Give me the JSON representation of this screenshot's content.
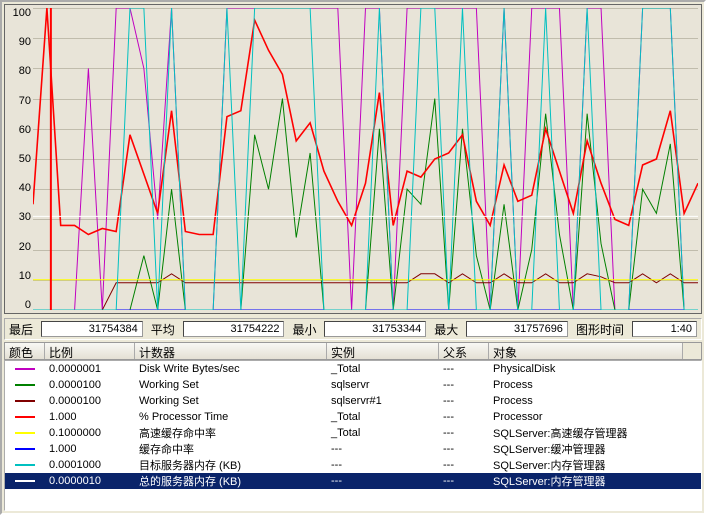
{
  "chart_data": {
    "type": "line",
    "ylim": [
      0,
      100
    ],
    "yticks": [
      100,
      90,
      80,
      70,
      60,
      50,
      40,
      30,
      20,
      10,
      0
    ],
    "series": [
      {
        "name": "Disk Write Bytes/sec",
        "color": "#c000c0",
        "values": [
          0,
          0,
          0,
          0,
          80,
          0,
          100,
          100,
          80,
          30,
          100,
          0,
          0,
          0,
          100,
          100,
          100,
          100,
          100,
          100,
          100,
          100,
          100,
          0,
          100,
          100,
          0,
          100,
          100,
          100,
          100,
          100,
          100,
          0,
          100,
          0,
          100,
          100,
          100,
          0,
          100,
          100,
          0,
          0,
          100,
          100,
          100,
          0,
          0
        ]
      },
      {
        "name": "Working Set sqlservr",
        "color": "#008000",
        "values": [
          0,
          0,
          0,
          0,
          0,
          0,
          0,
          0,
          18,
          0,
          40,
          0,
          0,
          0,
          0,
          0,
          58,
          40,
          70,
          24,
          52,
          0,
          0,
          0,
          0,
          60,
          0,
          40,
          35,
          70,
          0,
          60,
          18,
          0,
          35,
          0,
          20,
          65,
          25,
          0,
          65,
          22,
          0,
          0,
          40,
          32,
          55,
          0,
          0
        ]
      },
      {
        "name": "Working Set sqlservr#1",
        "color": "#800000",
        "values": [
          0,
          0,
          0,
          0,
          0,
          0,
          9,
          9,
          9,
          9,
          12,
          9,
          9,
          9,
          9,
          9,
          9,
          9,
          9,
          9,
          9,
          9,
          9,
          9,
          9,
          9,
          9,
          9,
          12,
          12,
          9,
          12,
          9,
          9,
          12,
          9,
          9,
          12,
          9,
          9,
          12,
          11,
          9,
          9,
          12,
          9,
          12,
          9,
          9
        ]
      },
      {
        "name": "% Processor Time",
        "color": "#ff0000",
        "values": [
          35,
          100,
          28,
          28,
          25,
          27,
          26,
          58,
          45,
          32,
          66,
          26,
          25,
          25,
          64,
          66,
          96,
          86,
          78,
          56,
          62,
          46,
          36,
          28,
          42,
          72,
          28,
          46,
          44,
          50,
          52,
          58,
          36,
          28,
          48,
          36,
          38,
          60,
          46,
          32,
          56,
          42,
          30,
          28,
          48,
          50,
          66,
          32,
          42
        ]
      },
      {
        "name": "高速缓存命中率",
        "color": "#ffff00",
        "values": [
          10,
          10,
          10,
          10,
          10,
          10,
          10,
          10,
          10,
          10,
          10,
          10,
          10,
          10,
          10,
          10,
          10,
          10,
          10,
          10,
          10,
          10,
          10,
          10,
          10,
          10,
          10,
          10,
          10,
          10,
          10,
          10,
          10,
          10,
          10,
          10,
          10,
          10,
          10,
          10,
          10,
          10,
          10,
          10,
          10,
          10,
          10,
          10,
          10
        ]
      },
      {
        "name": "缓存命中率",
        "color": "#0000ff",
        "values": [
          0,
          0,
          0,
          0,
          0,
          0,
          0,
          0,
          0,
          0,
          0,
          0,
          0,
          0,
          0,
          0,
          0,
          0,
          0,
          0,
          0,
          0,
          0,
          0,
          0,
          0,
          0,
          0,
          0,
          0,
          0,
          0,
          0,
          0,
          0,
          0,
          0,
          0,
          0,
          0,
          0,
          0,
          0,
          0,
          0,
          0,
          0,
          0,
          0
        ]
      },
      {
        "name": "目标服务器内存",
        "color": "#00c0c0",
        "values": [
          0,
          0,
          0,
          0,
          0,
          0,
          0,
          100,
          100,
          0,
          100,
          0,
          0,
          0,
          100,
          0,
          100,
          100,
          100,
          100,
          100,
          0,
          0,
          0,
          0,
          100,
          0,
          0,
          100,
          100,
          0,
          100,
          0,
          0,
          100,
          0,
          0,
          100,
          0,
          0,
          100,
          0,
          0,
          0,
          100,
          100,
          100,
          0,
          0
        ]
      },
      {
        "name": "总的服务器内存",
        "color": "#ffffff",
        "values": [
          31,
          31,
          31,
          31,
          31,
          31,
          31,
          31,
          31,
          31,
          31,
          31,
          31,
          31,
          31,
          31,
          31,
          31,
          31,
          31,
          31,
          31,
          31,
          31,
          31,
          31,
          31,
          31,
          31,
          31,
          31,
          31,
          31,
          31,
          31,
          31,
          31,
          31,
          31,
          31,
          31,
          31,
          31,
          31,
          31,
          31,
          31,
          31,
          31
        ]
      }
    ]
  },
  "stats": {
    "last_label": "最后",
    "last_value": "31754384",
    "avg_label": "平均",
    "avg_value": "31754222",
    "min_label": "最小",
    "min_value": "31753344",
    "max_label": "最大",
    "max_value": "31757696",
    "duration_label": "图形时间",
    "duration_value": "1:40"
  },
  "headers": {
    "color": "颜色",
    "scale": "比例",
    "counter": "计数器",
    "instance": "实例",
    "parent": "父系",
    "object": "对象"
  },
  "counters": [
    {
      "color": "#c000c0",
      "scale": "0.0000001",
      "counter": "Disk Write Bytes/sec",
      "instance": "_Total",
      "parent": "---",
      "object": "PhysicalDisk",
      "selected": false
    },
    {
      "color": "#008000",
      "scale": "0.0000100",
      "counter": "Working Set",
      "instance": "sqlservr",
      "parent": "---",
      "object": "Process",
      "selected": false
    },
    {
      "color": "#800000",
      "scale": "0.0000100",
      "counter": "Working Set",
      "instance": "sqlservr#1",
      "parent": "---",
      "object": "Process",
      "selected": false
    },
    {
      "color": "#ff0000",
      "scale": "1.000",
      "counter": "% Processor Time",
      "instance": "_Total",
      "parent": "---",
      "object": "Processor",
      "selected": false
    },
    {
      "color": "#ffff00",
      "scale": "0.1000000",
      "counter": "高速缓存命中率",
      "instance": "_Total",
      "parent": "---",
      "object": "SQLServer:高速缓存管理器",
      "selected": false
    },
    {
      "color": "#0000ff",
      "scale": "1.000",
      "counter": "缓存命中率",
      "instance": "---",
      "parent": "---",
      "object": "SQLServer:缓冲管理器",
      "selected": false
    },
    {
      "color": "#00c0c0",
      "scale": "0.0001000",
      "counter": "目标服务器内存 (KB)",
      "instance": "---",
      "parent": "---",
      "object": "SQLServer:内存管理器",
      "selected": false
    },
    {
      "color": "#ffffff",
      "scale": "0.0000010",
      "counter": "总的服务器内存 (KB)",
      "instance": "---",
      "parent": "---",
      "object": "SQLServer:内存管理器",
      "selected": true
    }
  ],
  "col_widths": {
    "color": 40,
    "scale": 90,
    "counter": 192,
    "instance": 112,
    "parent": 50,
    "object": 194
  }
}
